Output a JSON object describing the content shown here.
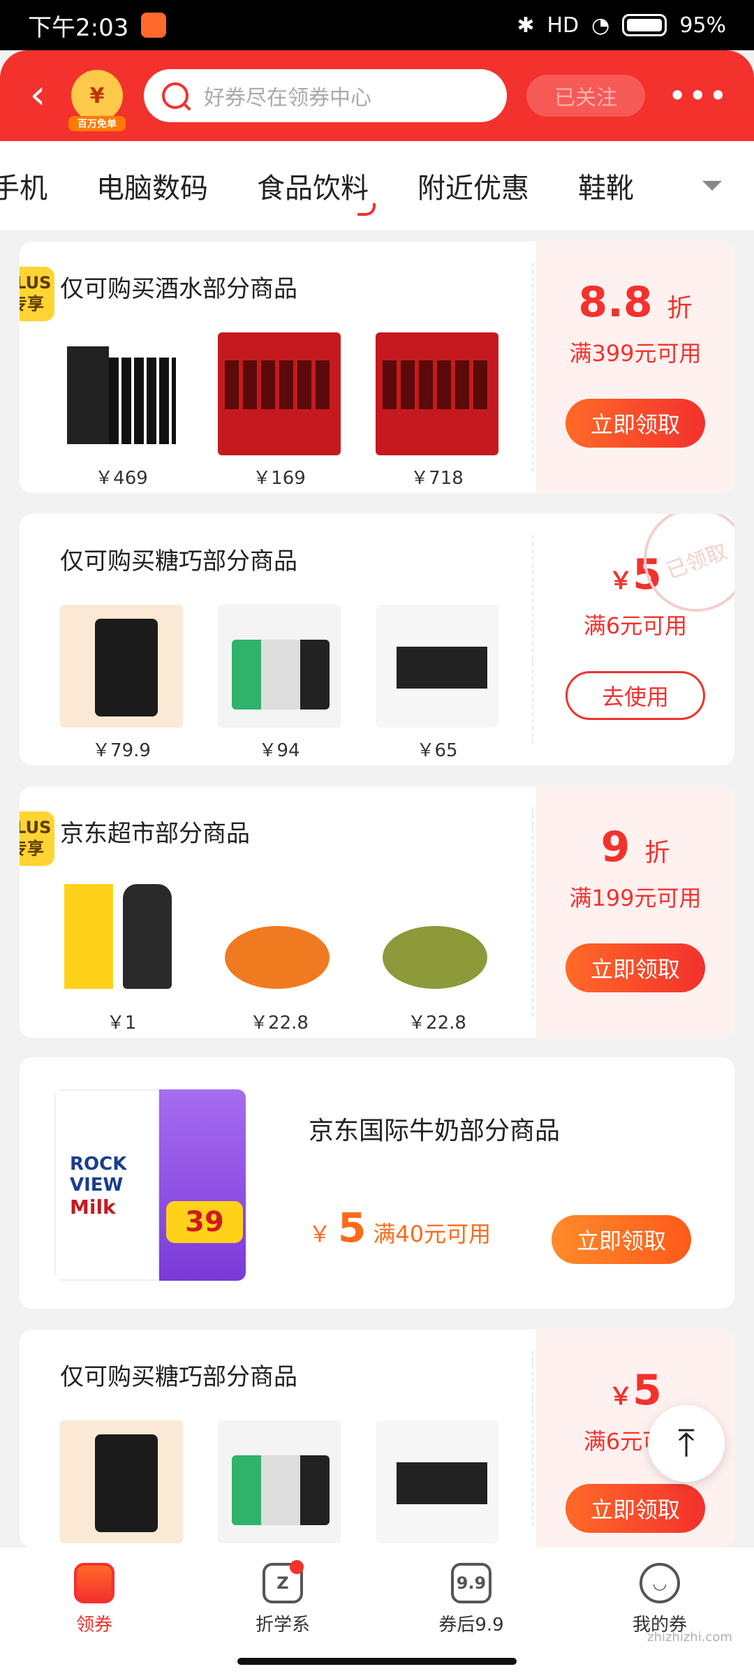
{
  "status_bar": {
    "time": "下午2:03",
    "battery": "95%",
    "net": "HD"
  },
  "header": {
    "badge_label": "百万免单",
    "badge_icon": "¥",
    "search_placeholder": "好券尽在领券中心",
    "follow_label": "已关注",
    "more_icon": "•••"
  },
  "tabs": [
    "手机",
    "电脑数码",
    "食品饮料",
    "附近优惠",
    "鞋靴"
  ],
  "active_tab_index": 2,
  "coupons": [
    {
      "plus": "PLUS\n专享",
      "title": "仅可购买酒水部分商品",
      "products": [
        {
          "price": "￥469"
        },
        {
          "price": "￥169"
        },
        {
          "price": "￥718"
        }
      ],
      "amount": "8.8",
      "unit": "折",
      "condition": "满399元可用",
      "button": "立即领取"
    },
    {
      "title": "仅可购买糖巧部分商品",
      "products": [
        {
          "price": "￥79.9"
        },
        {
          "price": "￥94"
        },
        {
          "price": "￥65"
        }
      ],
      "currency": "￥",
      "amount": "5",
      "condition": "满6元可用",
      "button": "去使用",
      "stamp": "已领取"
    },
    {
      "plus": "PLUS\n专享",
      "title": "京东超市部分商品",
      "products": [
        {
          "price": "￥1"
        },
        {
          "price": "￥22.8"
        },
        {
          "price": "￥22.8"
        }
      ],
      "amount": "9",
      "unit": "折",
      "condition": "满199元可用",
      "button": "立即领取"
    },
    {
      "title": "仅可购买糖巧部分商品",
      "currency": "￥",
      "amount": "5",
      "condition": "满6元可用",
      "button": "立即领取"
    }
  ],
  "milk_coupon": {
    "title": "京东国际牛奶部分商品",
    "currency": "￥",
    "amount": "5",
    "condition": "满40元可用",
    "button": "立即领取",
    "image_brand": "ROCK VIEW",
    "image_milk": "Milk",
    "image_price": "39"
  },
  "scroll_top_icon": "⤒",
  "bottom_nav": [
    {
      "label": "领券",
      "icon": "",
      "active": true
    },
    {
      "label": "折学系",
      "icon": "Z",
      "active": false,
      "dot": true
    },
    {
      "label": "券后9.9",
      "icon": "9.9",
      "active": false
    },
    {
      "label": "我的券",
      "icon": "◡",
      "active": false
    }
  ],
  "watermark": "zhizhizhi.com",
  "colors": {
    "primary": "#f3312d",
    "accent_orange": "#ff6a1a",
    "plus_yellow": "#ffd433"
  }
}
